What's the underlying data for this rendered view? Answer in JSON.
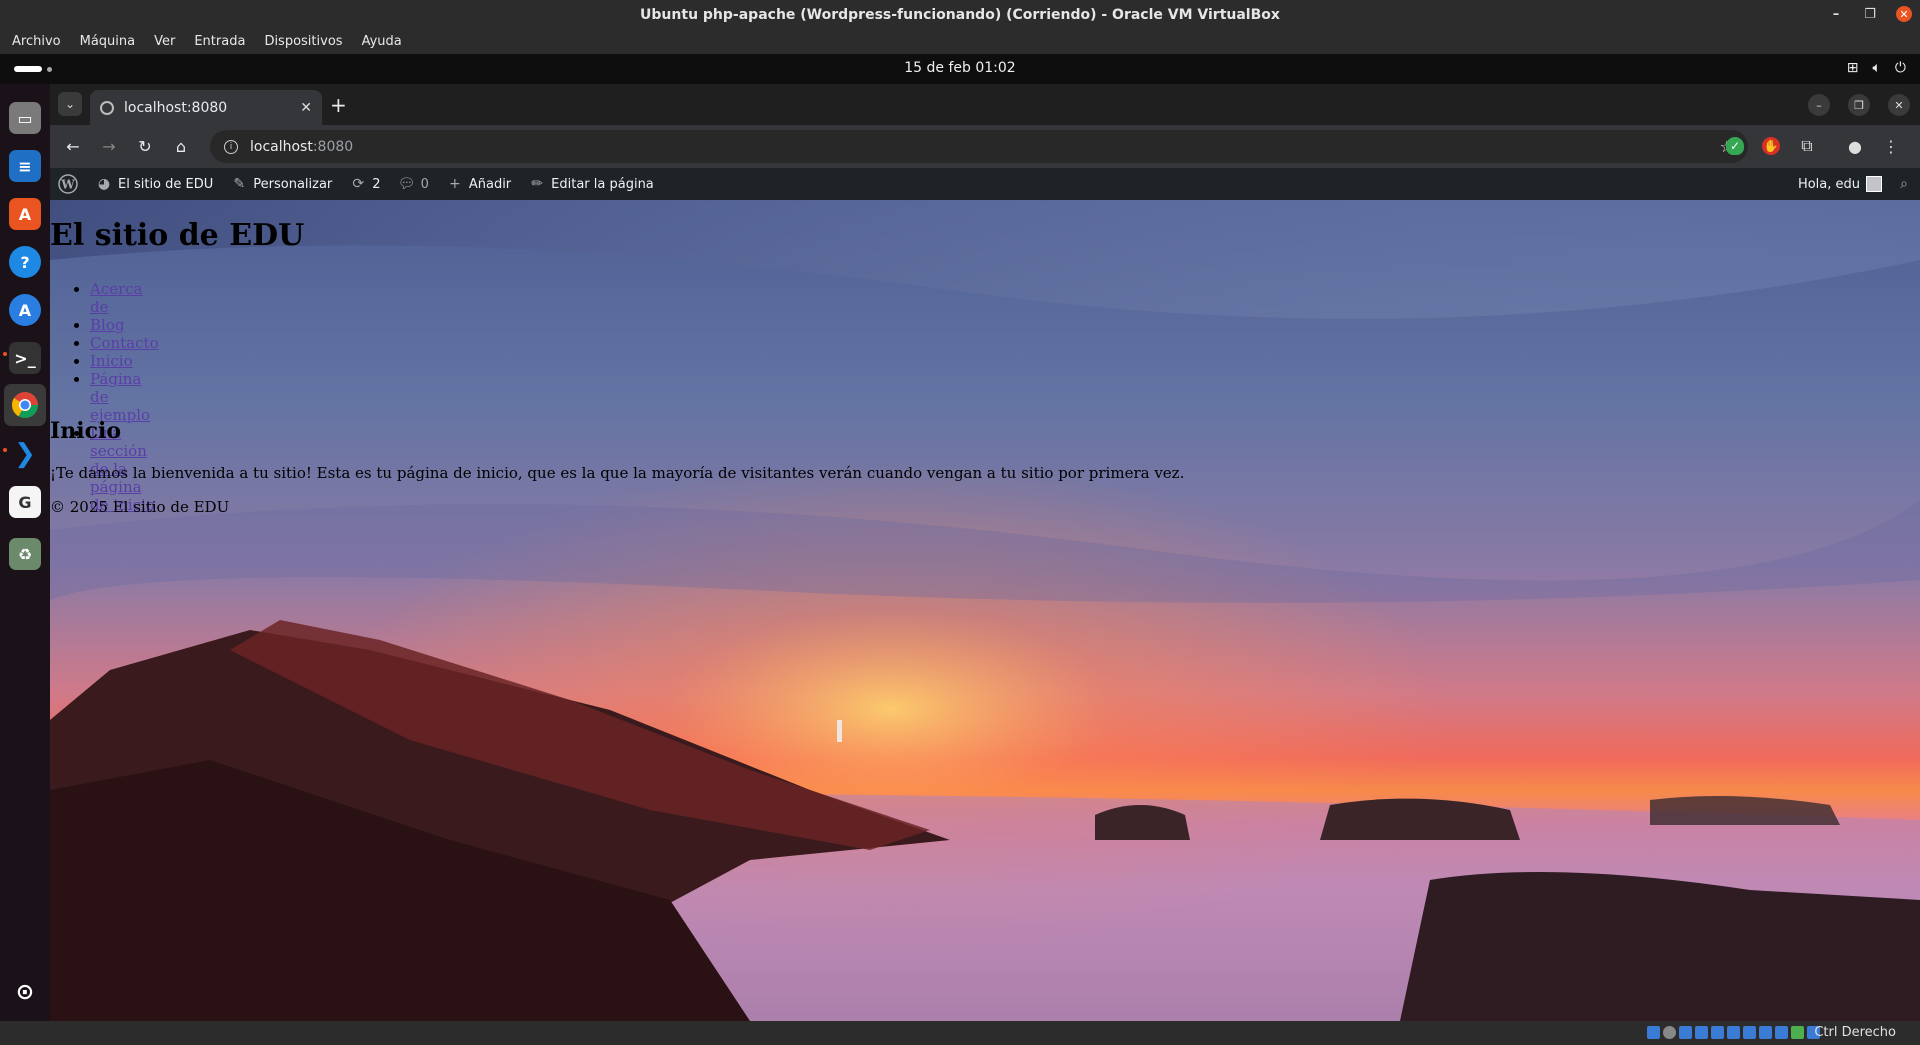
{
  "vbox": {
    "window_title": "Ubuntu php-apache (Wordpress-funcionando) (Corriendo) - Oracle VM VirtualBox",
    "menu": [
      "Archivo",
      "Máquina",
      "Ver",
      "Entrada",
      "Dispositivos",
      "Ayuda"
    ],
    "host_key": "Ctrl Derecho"
  },
  "gnome": {
    "clock": "15 de feb  01:02",
    "dock_items": [
      "files-icon",
      "writer-icon",
      "app-center-icon",
      "help-icon",
      "software-icon",
      "terminal-icon",
      "chrome-icon",
      "vscode-icon",
      "gimp-icon",
      "trash-icon",
      "show-apps-icon"
    ]
  },
  "browser": {
    "tab_title": "localhost:8080",
    "url_host": "localhost",
    "url_port": ":8080"
  },
  "wp_admin_bar": {
    "site_name": "El sitio de EDU",
    "customize": "Personalizar",
    "updates_count": "2",
    "comments_count": "0",
    "add_new": "Añadir",
    "edit_page": "Editar la página",
    "greeting": "Hola, edu"
  },
  "site": {
    "title": "El sitio de EDU",
    "nav": [
      "Acerca de",
      "Blog",
      "Contacto",
      "Inicio",
      "Página de ejemplo",
      "Una sección de la página de inicio"
    ],
    "page_heading": "Inicio",
    "page_body": "¡Te damos la bienvenida a tu sitio! Esta es tu página de inicio, que es la que la mayoría de visitantes verán cuando vengan a tu sitio por primera vez.",
    "footer": "© 2025 El sitio de EDU"
  },
  "colors": {
    "accent": "#e95420",
    "admin_bar": "#1d2327",
    "link": "#5a3ea8"
  }
}
